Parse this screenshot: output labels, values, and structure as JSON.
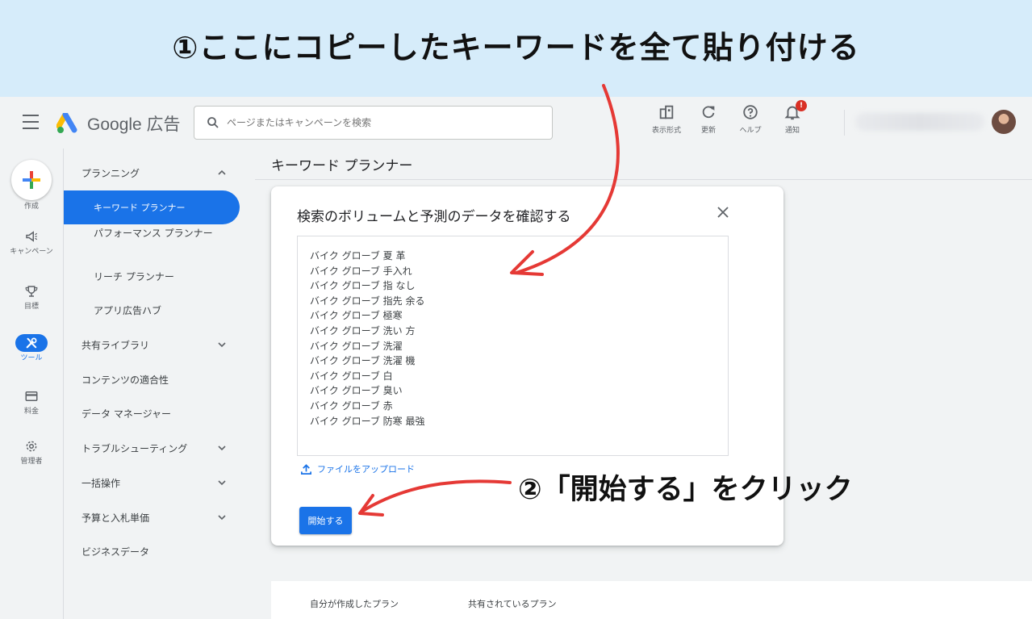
{
  "banner": {
    "instruction_1": "①ここにコピーしたキーワードを全て貼り付ける"
  },
  "annotations": {
    "instruction_2": "②「開始する」をクリック"
  },
  "header": {
    "logo_text": "Google 広告",
    "search_placeholder": "ページまたはキャンペーンを検索",
    "actions": [
      {
        "label": "表示形式",
        "icon": "display-format-icon"
      },
      {
        "label": "更新",
        "icon": "refresh-icon"
      },
      {
        "label": "ヘルプ",
        "icon": "help-icon"
      },
      {
        "label": "通知",
        "icon": "bell-icon"
      }
    ],
    "notification_badge": "!"
  },
  "rail": {
    "create": "作成",
    "campaigns": "キャンペーン",
    "goals": "目標",
    "tools": "ツール",
    "billing": "料金",
    "admin": "管理者"
  },
  "sidebar": {
    "planning": "プランニング",
    "keyword_planner": "キーワード プランナー",
    "performance_planner": "パフォーマンス プランナー",
    "reach_planner": "リーチ プランナー",
    "app_ads_hub": "アプリ広告ハブ",
    "shared_library": "共有ライブラリ",
    "content_suitability": "コンテンツの適合性",
    "data_manager": "データ マネージャー",
    "troubleshooting": "トラブルシューティング",
    "bulk_actions": "一括操作",
    "budgets_bidding": "予算と入札単価",
    "business_data": "ビジネスデータ"
  },
  "main": {
    "page_title": "キーワード プランナー",
    "card_title": "検索のボリュームと予測のデータを確認する",
    "keywords": [
      "バイク グローブ 夏 革",
      "バイク グローブ 手入れ",
      "バイク グローブ 指 なし",
      "バイク グローブ 指先 余る",
      "バイク グローブ 極寒",
      "バイク グローブ 洗い 方",
      "バイク グローブ 洗濯",
      "バイク グローブ 洗濯 機",
      "バイク グローブ 白",
      "バイク グローブ 臭い",
      "バイク グローブ 赤",
      "バイク グローブ 防寒 最強"
    ],
    "upload_label": "ファイルをアップロード",
    "start_button": "開始する",
    "tabs": [
      "自分が作成したプラン",
      "共有されているプラン"
    ]
  },
  "colors": {
    "accent": "#1a73e8",
    "banner_bg": "#d6ecfa",
    "annotation_arrow": "#e53935",
    "badge": "#d93025"
  }
}
